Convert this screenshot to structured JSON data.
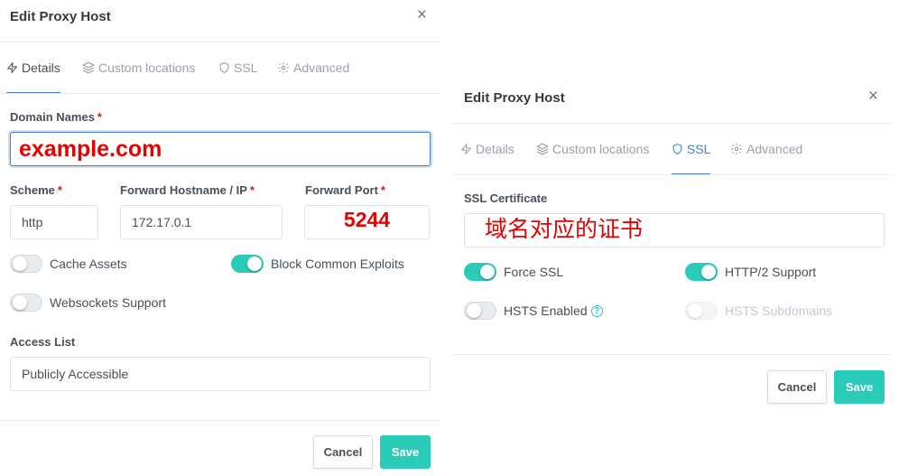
{
  "left": {
    "title": "Edit Proxy Host",
    "close": "×",
    "tabs": {
      "details": "Details",
      "custom_locations": "Custom locations",
      "ssl": "SSL",
      "advanced": "Advanced"
    },
    "domain_names": {
      "label": "Domain Names",
      "required": "*",
      "value": "example.com"
    },
    "scheme": {
      "label": "Scheme",
      "required": "*",
      "value": "http"
    },
    "forward_host": {
      "label": "Forward Hostname / IP",
      "required": "*",
      "value": "172.17.0.1"
    },
    "forward_port": {
      "label": "Forward Port",
      "required": "*",
      "value": "5244"
    },
    "toggles": {
      "cache_assets": {
        "label": "Cache Assets",
        "on": false
      },
      "block_exploits": {
        "label": "Block Common Exploits",
        "on": true
      },
      "websockets": {
        "label": "Websockets Support",
        "on": false
      }
    },
    "access_list": {
      "label": "Access List",
      "value": "Publicly Accessible"
    },
    "buttons": {
      "cancel": "Cancel",
      "save": "Save"
    }
  },
  "right": {
    "title": "Edit Proxy Host",
    "close": "×",
    "tabs": {
      "details": "Details",
      "custom_locations": "Custom locations",
      "ssl": "SSL",
      "advanced": "Advanced"
    },
    "ssl_certificate": {
      "label": "SSL Certificate",
      "value": "域名对应的证书"
    },
    "toggles": {
      "force_ssl": {
        "label": "Force SSL",
        "on": true
      },
      "http2": {
        "label": "HTTP/2 Support",
        "on": true
      },
      "hsts": {
        "label": "HSTS Enabled",
        "on": false,
        "help": "?"
      },
      "hsts_sub": {
        "label": "HSTS Subdomains",
        "on": false,
        "disabled": true
      }
    },
    "buttons": {
      "cancel": "Cancel",
      "save": "Save"
    }
  },
  "colors": {
    "accent": "#2bcbba",
    "primary": "#467fcf",
    "required": "#cd201f",
    "annotation": "#e60000"
  }
}
